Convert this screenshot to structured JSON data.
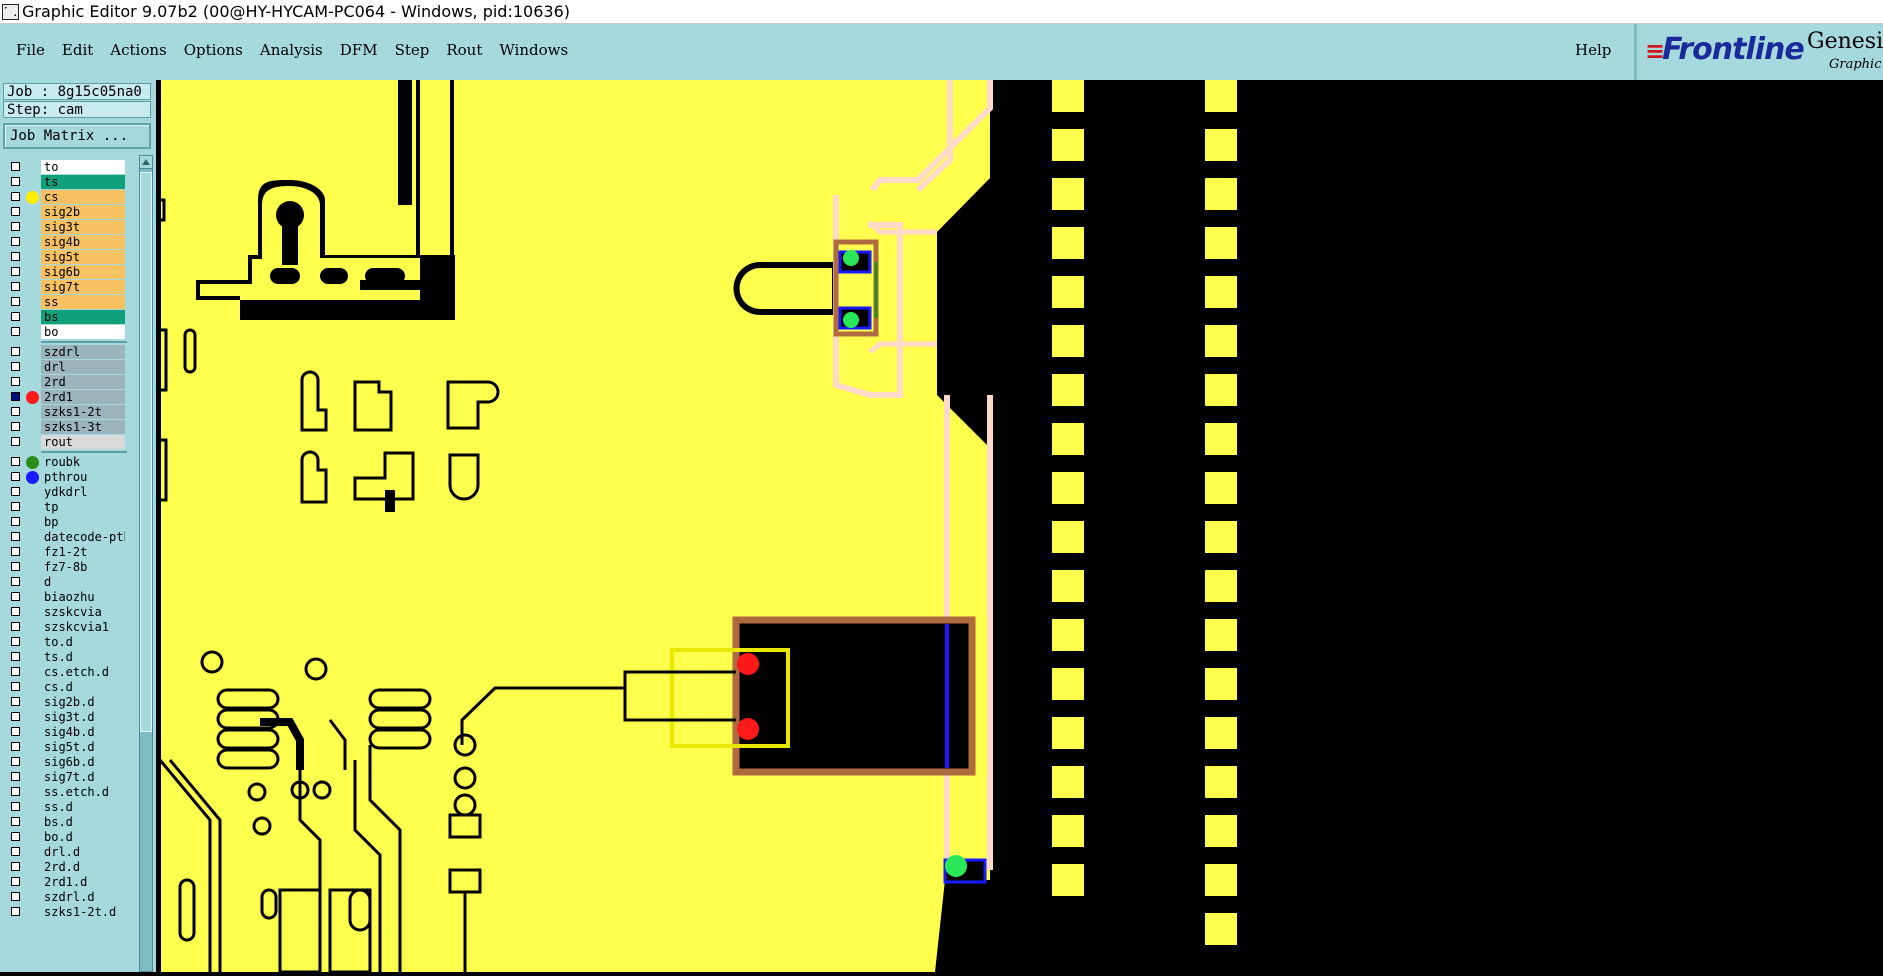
{
  "window": {
    "title": "Graphic Editor 9.07b2 (00@HY-HYCAM-PC064 - Windows, pid:10636)"
  },
  "menu": {
    "items": [
      "File",
      "Edit",
      "Actions",
      "Options",
      "Analysis",
      "DFM",
      "Step",
      "Rout",
      "Windows"
    ],
    "help": "Help"
  },
  "brand": {
    "logo": "Frontline",
    "product": "Genesis",
    "subtitle": "Graphic E"
  },
  "job": {
    "job_label": "Job : 8g15c05na0",
    "step_label": "Step: cam",
    "matrix_button": "Job Matrix ..."
  },
  "colors": {
    "board_bg": "#ffff4d",
    "copper_black": "#000000",
    "board_pads": "#ffff4d",
    "trace_outline": "#fcd9c8",
    "profile_brown": "#b06a40",
    "drill_red": "#ff1a1a",
    "via_green": "#28e85a",
    "pthrou_blue": "#1a1aff",
    "select_yellow": "#e8e800"
  },
  "layers": [
    {
      "name": "to",
      "color": "#ffffff",
      "dot": "",
      "checked": false
    },
    {
      "name": "ts",
      "color": "#10a07a",
      "dot": "",
      "checked": false
    },
    {
      "name": "cs",
      "color": "#f7c060",
      "dot": "#ffee00",
      "checked": false
    },
    {
      "name": "sig2b",
      "color": "#f7c060",
      "dot": "",
      "checked": false
    },
    {
      "name": "sig3t",
      "color": "#f7c060",
      "dot": "",
      "checked": false
    },
    {
      "name": "sig4b",
      "color": "#f7c060",
      "dot": "",
      "checked": false
    },
    {
      "name": "sig5t",
      "color": "#f7c060",
      "dot": "",
      "checked": false
    },
    {
      "name": "sig6b",
      "color": "#f7c060",
      "dot": "",
      "checked": false
    },
    {
      "name": "sig7t",
      "color": "#f7c060",
      "dot": "",
      "checked": false
    },
    {
      "name": "ss",
      "color": "#f7c060",
      "dot": "",
      "checked": false
    },
    {
      "name": "bs",
      "color": "#10a07a",
      "dot": "",
      "checked": false
    },
    {
      "name": "bo",
      "color": "#ffffff",
      "dot": "",
      "checked": false
    },
    {
      "name": "szdrl",
      "color": "#9cb4bc",
      "dot": "",
      "checked": false
    },
    {
      "name": "drl",
      "color": "#9cb4bc",
      "dot": "",
      "checked": false
    },
    {
      "name": "2rd",
      "color": "#9cb4bc",
      "dot": "",
      "checked": false
    },
    {
      "name": "2rd1",
      "color": "#9cb4bc",
      "dot": "#ff1a1a",
      "checked": true
    },
    {
      "name": "szks1-2t",
      "color": "#9cb4bc",
      "dot": "",
      "checked": false
    },
    {
      "name": "szks1-3t",
      "color": "#9cb4bc",
      "dot": "",
      "checked": false
    },
    {
      "name": "rout",
      "color": "#d9d9d9",
      "dot": "",
      "checked": false
    },
    {
      "name": "roubk",
      "color": "#a6d9dd",
      "dot": "#2c8c1c",
      "checked": false
    },
    {
      "name": "pthrou",
      "color": "#a6d9dd",
      "dot": "#1a1aff",
      "checked": false
    },
    {
      "name": "ydkdrl",
      "color": "#a6d9dd",
      "dot": "",
      "checked": false
    },
    {
      "name": "tp",
      "color": "#a6d9dd",
      "dot": "",
      "checked": false
    },
    {
      "name": "bp",
      "color": "#a6d9dd",
      "dot": "",
      "checked": false
    },
    {
      "name": "datecode-pth",
      "color": "#a6d9dd",
      "dot": "",
      "checked": false
    },
    {
      "name": "fz1-2t",
      "color": "#a6d9dd",
      "dot": "",
      "checked": false
    },
    {
      "name": "fz7-8b",
      "color": "#a6d9dd",
      "dot": "",
      "checked": false
    },
    {
      "name": "d",
      "color": "#a6d9dd",
      "dot": "",
      "checked": false
    },
    {
      "name": "biaozhu",
      "color": "#a6d9dd",
      "dot": "",
      "checked": false
    },
    {
      "name": "szskcvia",
      "color": "#a6d9dd",
      "dot": "",
      "checked": false
    },
    {
      "name": "szskcvia1",
      "color": "#a6d9dd",
      "dot": "",
      "checked": false
    },
    {
      "name": "to.d",
      "color": "#a6d9dd",
      "dot": "",
      "checked": false
    },
    {
      "name": "ts.d",
      "color": "#a6d9dd",
      "dot": "",
      "checked": false
    },
    {
      "name": "cs.etch.d",
      "color": "#a6d9dd",
      "dot": "",
      "checked": false
    },
    {
      "name": "cs.d",
      "color": "#a6d9dd",
      "dot": "",
      "checked": false
    },
    {
      "name": "sig2b.d",
      "color": "#a6d9dd",
      "dot": "",
      "checked": false
    },
    {
      "name": "sig3t.d",
      "color": "#a6d9dd",
      "dot": "",
      "checked": false
    },
    {
      "name": "sig4b.d",
      "color": "#a6d9dd",
      "dot": "",
      "checked": false
    },
    {
      "name": "sig5t.d",
      "color": "#a6d9dd",
      "dot": "",
      "checked": false
    },
    {
      "name": "sig6b.d",
      "color": "#a6d9dd",
      "dot": "",
      "checked": false
    },
    {
      "name": "sig7t.d",
      "color": "#a6d9dd",
      "dot": "",
      "checked": false
    },
    {
      "name": "ss.etch.d",
      "color": "#a6d9dd",
      "dot": "",
      "checked": false
    },
    {
      "name": "ss.d",
      "color": "#a6d9dd",
      "dot": "",
      "checked": false
    },
    {
      "name": "bs.d",
      "color": "#a6d9dd",
      "dot": "",
      "checked": false
    },
    {
      "name": "bo.d",
      "color": "#a6d9dd",
      "dot": "",
      "checked": false
    },
    {
      "name": "drl.d",
      "color": "#a6d9dd",
      "dot": "",
      "checked": false
    },
    {
      "name": "2rd.d",
      "color": "#a6d9dd",
      "dot": "",
      "checked": false
    },
    {
      "name": "2rd1.d",
      "color": "#a6d9dd",
      "dot": "",
      "checked": false
    },
    {
      "name": "szdrl.d",
      "color": "#a6d9dd",
      "dot": "",
      "checked": false
    },
    {
      "name": "szks1-2t.d",
      "color": "#a6d9dd",
      "dot": "",
      "checked": false
    }
  ]
}
